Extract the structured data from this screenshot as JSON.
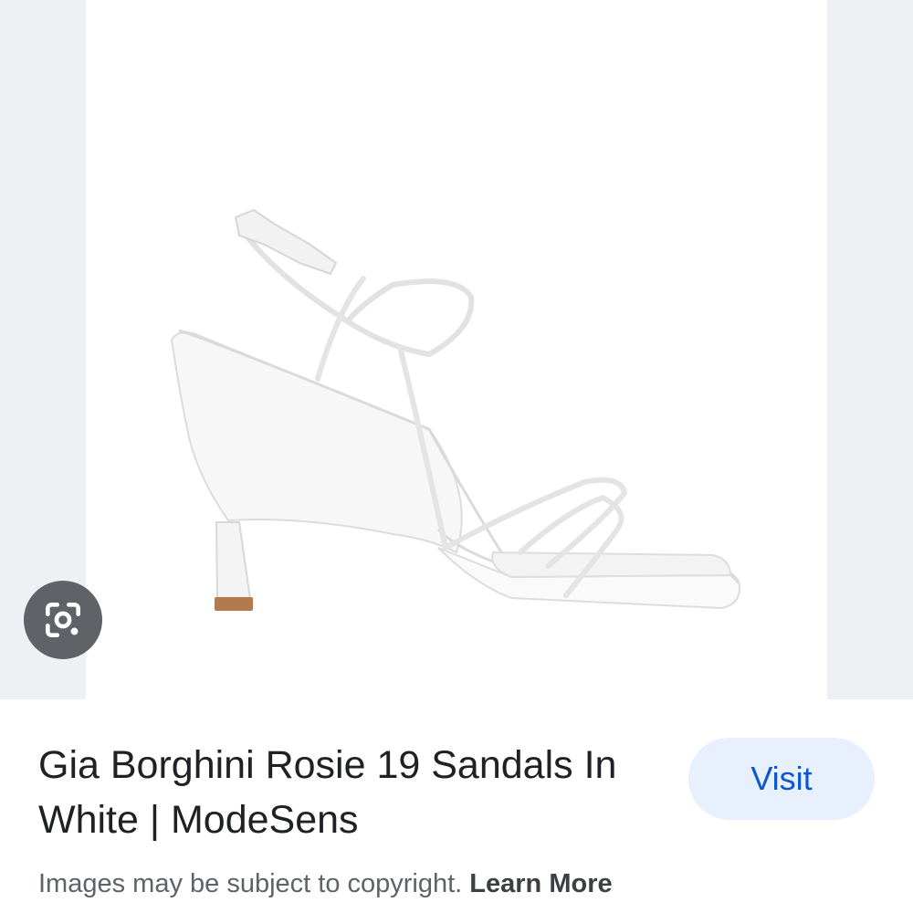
{
  "result": {
    "title": "Gia Borghini Rosie 19 Sandals In White | ModeSens",
    "visit_label": "Visit"
  },
  "footer": {
    "copyright_text": "Images may be subject to copyright. ",
    "learn_more_label": "Learn More"
  },
  "icons": {
    "lens": "google-lens-icon"
  },
  "colors": {
    "visit_bg": "#e8f0fe",
    "visit_text": "#0b57d0",
    "lens_bg": "#5f6368",
    "side_bg": "#eef0f3"
  }
}
